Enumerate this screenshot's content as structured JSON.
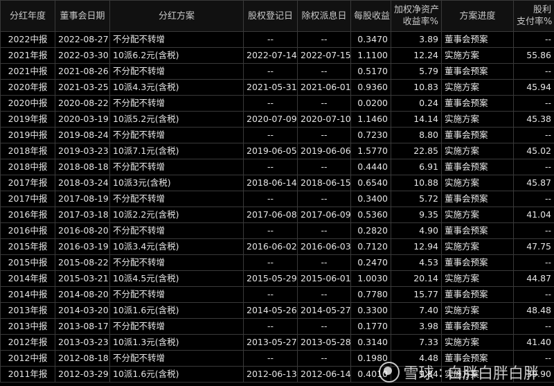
{
  "table": {
    "headers": [
      "分红年度",
      "董事会日期",
      "分红方案",
      "股权登记日",
      "除权派息日",
      "每股收益",
      "加权净资产\n收益率%",
      "方案进度",
      "股利\n支付率%"
    ],
    "rows": [
      [
        "2022中报",
        "2022-08-27",
        "不分配不转增",
        "--",
        "--",
        "0.3470",
        "3.89",
        "董事会预案",
        "--"
      ],
      [
        "2021年报",
        "2022-03-30",
        "10派6.2元(含税)",
        "2022-07-14",
        "2022-07-15",
        "1.1100",
        "12.24",
        "实施方案",
        "55.86"
      ],
      [
        "2021中报",
        "2021-08-26",
        "不分配不转增",
        "--",
        "--",
        "0.5170",
        "5.79",
        "董事会预案",
        "--"
      ],
      [
        "2020年报",
        "2021-03-25",
        "10派4.3元(含税)",
        "2021-05-31",
        "2021-06-01",
        "0.9360",
        "10.83",
        "实施方案",
        "45.94"
      ],
      [
        "2020中报",
        "2020-08-22",
        "不分配不转增",
        "--",
        "--",
        "0.0200",
        "0.24",
        "董事会预案",
        "--"
      ],
      [
        "2019年报",
        "2020-03-19",
        "10派5.2元(含税)",
        "2020-07-09",
        "2020-07-10",
        "1.1460",
        "14.14",
        "实施方案",
        "45.38"
      ],
      [
        "2019中报",
        "2019-08-24",
        "不分配不转增",
        "--",
        "--",
        "0.7230",
        "8.80",
        "董事会预案",
        "--"
      ],
      [
        "2018年报",
        "2019-03-23",
        "10派7.1元(含税)",
        "2019-06-05",
        "2019-06-06",
        "1.5770",
        "22.85",
        "实施方案",
        "45.02"
      ],
      [
        "2018中报",
        "2018-08-18",
        "不分配不转增",
        "--",
        "--",
        "0.4440",
        "6.91",
        "董事会预案",
        "--"
      ],
      [
        "2017年报",
        "2018-03-24",
        "10派3元(含税)",
        "2018-06-14",
        "2018-06-15",
        "0.6540",
        "10.88",
        "实施方案",
        "45.87"
      ],
      [
        "2017中报",
        "2017-08-19",
        "不分配不转增",
        "--",
        "--",
        "0.3400",
        "5.72",
        "董事会预案",
        "--"
      ],
      [
        "2016年报",
        "2017-03-18",
        "10派2.2元(含税)",
        "2017-06-08",
        "2017-06-09",
        "0.5360",
        "9.35",
        "实施方案",
        "41.04"
      ],
      [
        "2016中报",
        "2016-08-20",
        "不分配不转增",
        "--",
        "--",
        "0.2820",
        "4.90",
        "董事会预案",
        "--"
      ],
      [
        "2015年报",
        "2016-03-19",
        "10派3.4元(含税)",
        "2016-06-02",
        "2016-06-03",
        "0.7120",
        "12.94",
        "实施方案",
        "47.75"
      ],
      [
        "2015中报",
        "2015-08-22",
        "不分配不转增",
        "--",
        "--",
        "0.2470",
        "4.53",
        "董事会预案",
        "--"
      ],
      [
        "2014年报",
        "2015-03-21",
        "10派4.5元(含税)",
        "2015-05-29",
        "2015-06-01",
        "1.0030",
        "20.14",
        "实施方案",
        "44.87"
      ],
      [
        "2014中报",
        "2014-08-20",
        "不分配不转增",
        "--",
        "--",
        "0.7780",
        "15.77",
        "董事会预案",
        "--"
      ],
      [
        "2013年报",
        "2014-03-20",
        "10派1.6元(含税)",
        "2014-05-26",
        "2014-05-27",
        "0.3300",
        "7.40",
        "实施方案",
        "48.48"
      ],
      [
        "2013中报",
        "2013-08-17",
        "不分配不转增",
        "--",
        "--",
        "0.1770",
        "3.98",
        "董事会预案",
        "--"
      ],
      [
        "2012年报",
        "2013-03-23",
        "10派1.3元(含税)",
        "2013-05-27",
        "2013-05-28",
        "0.3140",
        "7.33",
        "实施方案",
        "41.40"
      ],
      [
        "2012中报",
        "2012-08-18",
        "不分配不转增",
        "--",
        "--",
        "0.1980",
        "4.48",
        "董事会预案",
        "--"
      ],
      [
        "2011年报",
        "2012-03-29",
        "10派1.6元(含税)",
        "2012-06-13",
        "2012-06-14",
        "0.4010",
        "9.84",
        "实施方案",
        "39.90"
      ]
    ]
  },
  "watermark": {
    "brand": "雪球",
    "author": "白胖白胖白胖"
  },
  "colors": {
    "background": "#000000",
    "text": "#e6e6e6",
    "border": "#3a3a3a"
  }
}
